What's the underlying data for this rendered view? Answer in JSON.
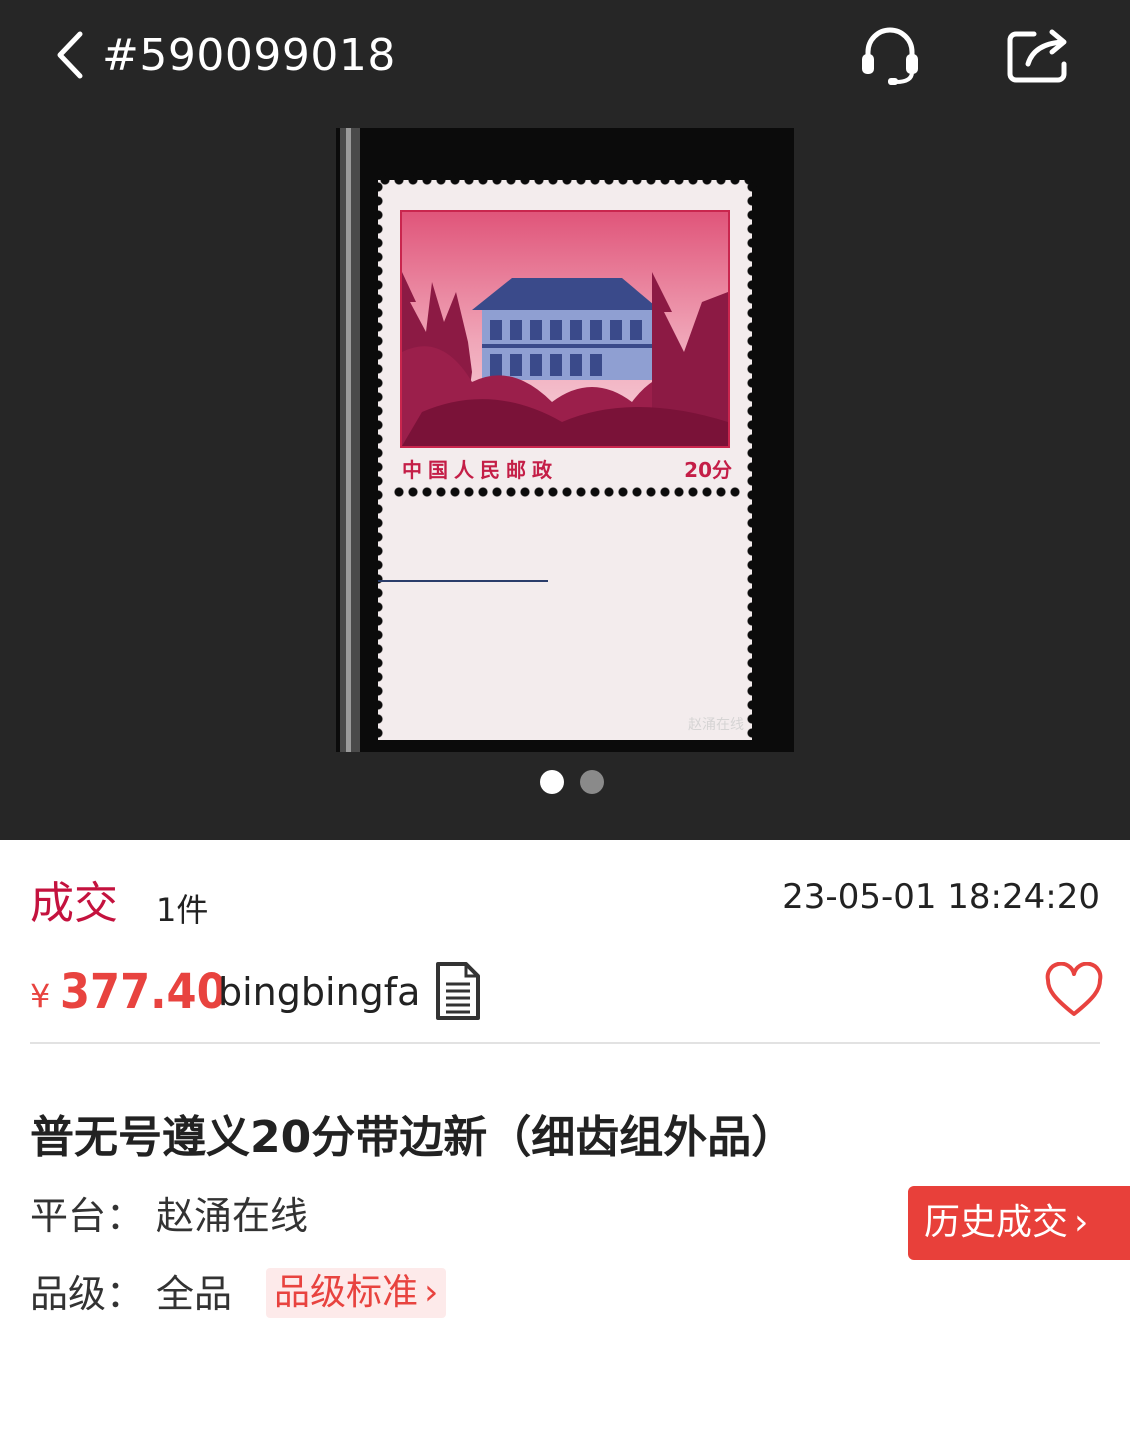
{
  "header": {
    "item_id": "#590099018",
    "back_icon": "chevron-left-icon",
    "support_icon": "headset-icon",
    "share_icon": "share-icon"
  },
  "gallery": {
    "image_count": 2,
    "active_index": 0,
    "stamp": {
      "inscription": "中国人民邮政",
      "denomination": "20分",
      "watermark": "赵涌在线"
    }
  },
  "deal": {
    "status": "成交",
    "quantity": "1件",
    "time": "23-05-01 18:24:20",
    "currency_symbol": "¥",
    "price": "377.40",
    "seller": "bingbingfa"
  },
  "item": {
    "title": "普无号遵义20分带边新（细齿组外品）",
    "platform_label": "平台：",
    "platform_value": "赵涌在线",
    "grade_label": "品级：",
    "grade_value": "全品",
    "grade_standard_link": "品级标准",
    "history_button": "历史成交"
  },
  "colors": {
    "accent_red": "#e8433f",
    "status_red": "#c4123e",
    "dark_bg": "#262626"
  }
}
